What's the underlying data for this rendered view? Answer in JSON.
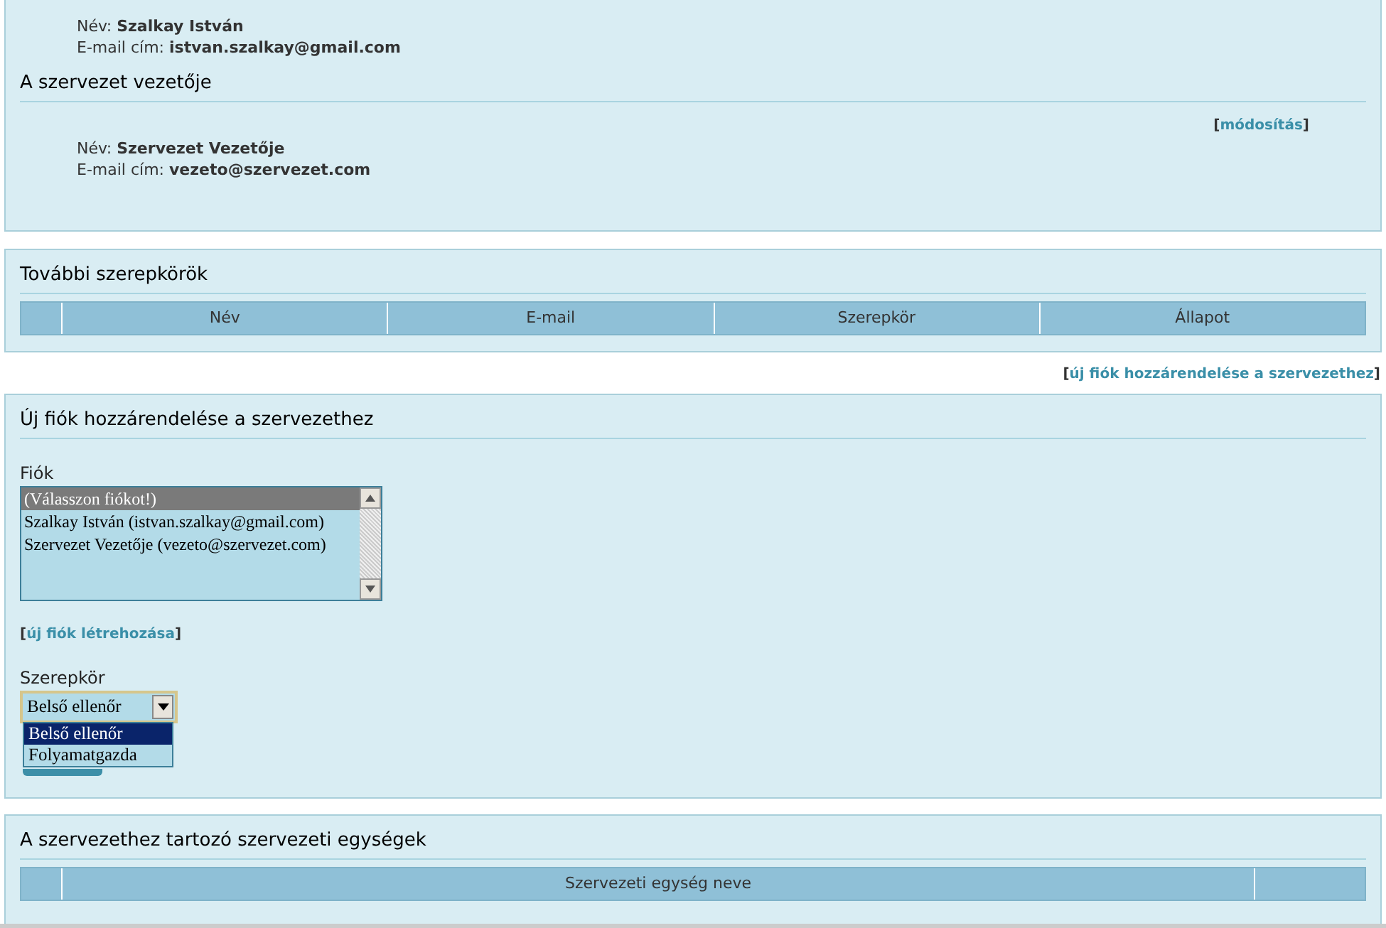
{
  "contact_person": {
    "name_label": "Név:",
    "name": "Szalkay István",
    "email_label": "E-mail cím:",
    "email": "istvan.szalkay@gmail.com"
  },
  "leader": {
    "title": "A szervezet vezetője",
    "edit_link": {
      "open": "[",
      "label": "módosítás",
      "close": "]"
    },
    "name_label": "Név:",
    "name": "Szervezet Vezetője",
    "email_label": "E-mail cím:",
    "email": "vezeto@szervezet.com"
  },
  "roles": {
    "title": "További szerepkörök",
    "columns": [
      "",
      "Név",
      "E-mail",
      "Szerepkör",
      "Állapot"
    ]
  },
  "assign_link": {
    "open": "[",
    "label": "új fiók hozzárendelése a szervezethez",
    "close": "]"
  },
  "assign": {
    "title": "Új fiók hozzárendelése a szervezethez",
    "account_label": "Fiók",
    "accounts": [
      {
        "label": "(Válasszon fiókot!)",
        "selected": true
      },
      {
        "label": "Szalkay István (istvan.szalkay@gmail.com)",
        "selected": false
      },
      {
        "label": "Szervezet Vezetője (vezeto@szervezet.com)",
        "selected": false
      }
    ],
    "new_account_link": {
      "open": "[",
      "label": "új fiók létrehozása",
      "close": "]"
    },
    "role_label": "Szerepkör",
    "role_value": "Belső ellenőr",
    "role_options": [
      {
        "label": "Belső ellenőr",
        "selected": true
      },
      {
        "label": "Folyamatgazda",
        "selected": false
      }
    ]
  },
  "units": {
    "title": "A szervezethez tartozó szervezeti egységek",
    "columns": [
      "",
      "Szervezeti egység neve",
      ""
    ]
  }
}
